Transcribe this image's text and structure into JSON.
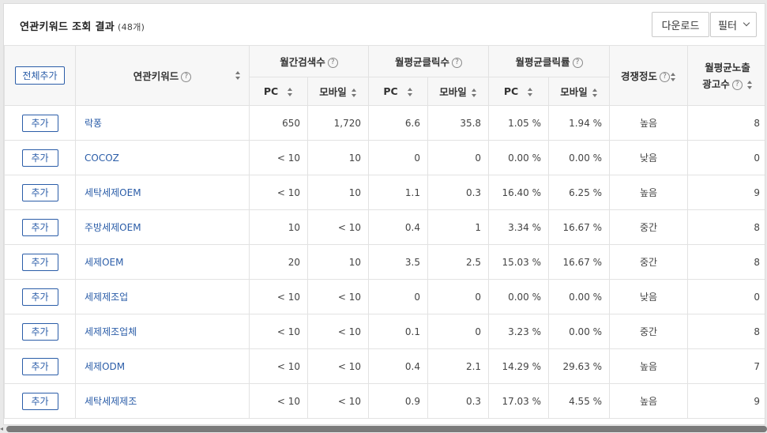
{
  "header": {
    "title": "연관키워드 조회 결과",
    "count": "(48개)",
    "download_label": "다운로드",
    "filter_label": "필터"
  },
  "columns": {
    "add_all": "전체추가",
    "keyword": "연관키워드",
    "monthly_search": "월간검색수",
    "monthly_clicks": "월평균클릭수",
    "monthly_ctr": "월평균클릭률",
    "competition": "경쟁정도",
    "ads_line1": "월평균노출",
    "ads_line2": "광고수",
    "pc": "PC",
    "mobile": "모바일",
    "help_glyph": "?"
  },
  "add_label": "추가",
  "rows": [
    {
      "keyword": "락퐁",
      "pc_search": "650",
      "mo_search": "1,720",
      "pc_click": "6.6",
      "mo_click": "35.8",
      "pc_ctr": "1.05 %",
      "mo_ctr": "1.94 %",
      "competition": "높음",
      "ads": "8"
    },
    {
      "keyword": "COCOZ",
      "pc_search": "< 10",
      "mo_search": "10",
      "pc_click": "0",
      "mo_click": "0",
      "pc_ctr": "0.00 %",
      "mo_ctr": "0.00 %",
      "competition": "낮음",
      "ads": "0"
    },
    {
      "keyword": "세탁세제OEM",
      "pc_search": "< 10",
      "mo_search": "10",
      "pc_click": "1.1",
      "mo_click": "0.3",
      "pc_ctr": "16.40 %",
      "mo_ctr": "6.25 %",
      "competition": "높음",
      "ads": "9"
    },
    {
      "keyword": "주방세제OEM",
      "pc_search": "10",
      "mo_search": "< 10",
      "pc_click": "0.4",
      "mo_click": "1",
      "pc_ctr": "3.34 %",
      "mo_ctr": "16.67 %",
      "competition": "중간",
      "ads": "8"
    },
    {
      "keyword": "세제OEM",
      "pc_search": "20",
      "mo_search": "10",
      "pc_click": "3.5",
      "mo_click": "2.5",
      "pc_ctr": "15.03 %",
      "mo_ctr": "16.67 %",
      "competition": "중간",
      "ads": "8"
    },
    {
      "keyword": "세제제조업",
      "pc_search": "< 10",
      "mo_search": "< 10",
      "pc_click": "0",
      "mo_click": "0",
      "pc_ctr": "0.00 %",
      "mo_ctr": "0.00 %",
      "competition": "낮음",
      "ads": "0"
    },
    {
      "keyword": "세제제조업체",
      "pc_search": "< 10",
      "mo_search": "< 10",
      "pc_click": "0.1",
      "mo_click": "0",
      "pc_ctr": "3.23 %",
      "mo_ctr": "0.00 %",
      "competition": "중간",
      "ads": "8"
    },
    {
      "keyword": "세제ODM",
      "pc_search": "< 10",
      "mo_search": "< 10",
      "pc_click": "0.4",
      "mo_click": "2.1",
      "pc_ctr": "14.29 %",
      "mo_ctr": "29.63 %",
      "competition": "높음",
      "ads": "7"
    },
    {
      "keyword": "세탁세제제조",
      "pc_search": "< 10",
      "mo_search": "< 10",
      "pc_click": "0.9",
      "mo_click": "0.3",
      "pc_ctr": "17.03 %",
      "mo_ctr": "4.55 %",
      "competition": "높음",
      "ads": "9"
    }
  ],
  "colors": {
    "link_blue": "#2b5da8",
    "header_bg": "#f7f7f7",
    "border": "#e2e2e2"
  }
}
